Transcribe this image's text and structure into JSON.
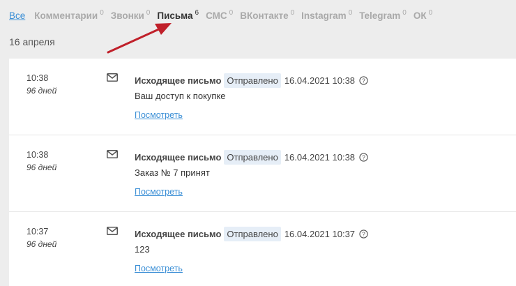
{
  "tabs": [
    {
      "label": "Все",
      "count": ""
    },
    {
      "label": "Комментарии",
      "count": "0"
    },
    {
      "label": "Звонки",
      "count": "0"
    },
    {
      "label": "Письма",
      "count": "6"
    },
    {
      "label": "СМС",
      "count": "0"
    },
    {
      "label": "ВКонтакте",
      "count": "0"
    },
    {
      "label": "Instagram",
      "count": "0"
    },
    {
      "label": "Telegram",
      "count": "0"
    },
    {
      "label": "ОК",
      "count": "0"
    }
  ],
  "date_header": "16 апреля",
  "entries": [
    {
      "time": "10:38",
      "ago": "96 дней",
      "type": "Исходящее письмо",
      "status": "Отправлено",
      "when": "16.04.2021 10:38",
      "subject": "Ваш доступ к покупке",
      "link": "Посмотреть"
    },
    {
      "time": "10:38",
      "ago": "96 дней",
      "type": "Исходящее письмо",
      "status": "Отправлено",
      "when": "16.04.2021 10:38",
      "subject": "Заказ № 7 принят",
      "link": "Посмотреть"
    },
    {
      "time": "10:37",
      "ago": "96 дней",
      "type": "Исходящее письмо",
      "status": "Отправлено",
      "when": "16.04.2021 10:37",
      "subject": "123",
      "link": "Посмотреть"
    }
  ],
  "colors": {
    "accent": "#3b8fd6",
    "annotation_arrow": "#c0202a",
    "status_badge_bg": "#e6eef7"
  },
  "icons": {
    "entry": "envelope-icon",
    "help": "question-circle-icon"
  }
}
